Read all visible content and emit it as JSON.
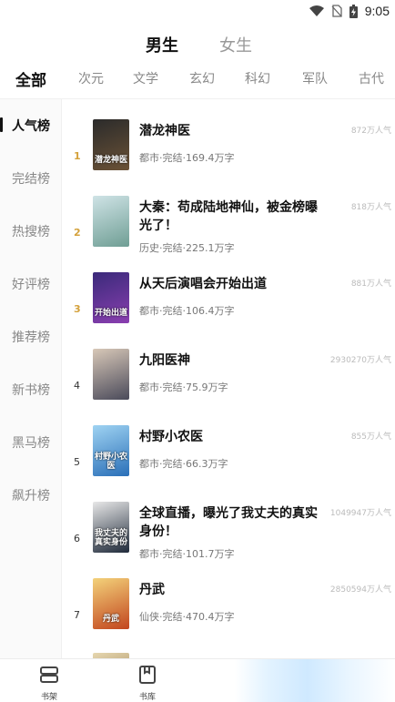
{
  "status_bar": {
    "time": "9:05",
    "icons": [
      "wifi-icon",
      "no-sim-icon",
      "battery-charging-icon"
    ]
  },
  "gender_tabs": [
    {
      "label": "男生",
      "active": true
    },
    {
      "label": "女生",
      "active": false
    }
  ],
  "categories": [
    "全部",
    "次元",
    "文学",
    "玄幻",
    "科幻",
    "军队",
    "古代"
  ],
  "rank_menu": [
    "人气榜",
    "完结榜",
    "热搜榜",
    "好评榜",
    "推荐榜",
    "新书榜",
    "黑马榜",
    "飙升榜"
  ],
  "books": [
    {
      "rank": "1",
      "title": "潜龙神医",
      "genre": "都市",
      "status": "完结",
      "words": "169.4万字",
      "meta": "都市·完结·169.4万字",
      "popularity": "872万人气",
      "cover_text": "潜龙神医",
      "cover_colors": [
        "#2b2b2b",
        "#6b5236"
      ]
    },
    {
      "rank": "2",
      "title": "大秦：苟成陆地神仙，被金榜曝光了！",
      "genre": "历史",
      "status": "完结",
      "words": "225.1万字",
      "meta": "历史·完结·225.1万字",
      "popularity": "818万人气",
      "cover_text": "",
      "cover_colors": [
        "#cfe3e6",
        "#6f9e94"
      ]
    },
    {
      "rank": "3",
      "title": "从天后演唱会开始出道",
      "genre": "都市",
      "status": "完结",
      "words": "106.4万字",
      "meta": "都市·完结·106.4万字",
      "popularity": "881万人气",
      "cover_text": "开始出道",
      "cover_colors": [
        "#3a2a7a",
        "#8a3fb0"
      ]
    },
    {
      "rank": "4",
      "title": "九阳医神",
      "genre": "都市",
      "status": "完结",
      "words": "75.9万字",
      "meta": "都市·完结·75.9万字",
      "popularity": "2930270万人气",
      "cover_text": "",
      "cover_colors": [
        "#d8c8b8",
        "#4a4a5a"
      ]
    },
    {
      "rank": "5",
      "title": "村野小农医",
      "genre": "都市",
      "status": "完结",
      "words": "66.3万字",
      "meta": "都市·完结·66.3万字",
      "popularity": "855万人气",
      "cover_text": "村野小农医",
      "cover_colors": [
        "#9fd3f2",
        "#2a6fb8"
      ]
    },
    {
      "rank": "6",
      "title": "全球直播，曝光了我丈夫的真实身份！",
      "genre": "都市",
      "status": "完结",
      "words": "101.7万字",
      "meta": "都市·完结·101.7万字",
      "popularity": "1049947万人气",
      "cover_text": "我丈夫的真实身份",
      "cover_colors": [
        "#e8e8e8",
        "#1f2a3a"
      ]
    },
    {
      "rank": "7",
      "title": "丹武",
      "genre": "仙侠",
      "status": "完结",
      "words": "470.4万字",
      "meta": "仙侠·完结·470.4万字",
      "popularity": "2850594万人气",
      "cover_text": "丹武",
      "cover_colors": [
        "#f3d27a",
        "#c2451e"
      ]
    }
  ],
  "bottom_nav": [
    {
      "label": "书架",
      "icon": "bookshelf-icon"
    },
    {
      "label": "书库",
      "icon": "book-library-icon"
    }
  ]
}
